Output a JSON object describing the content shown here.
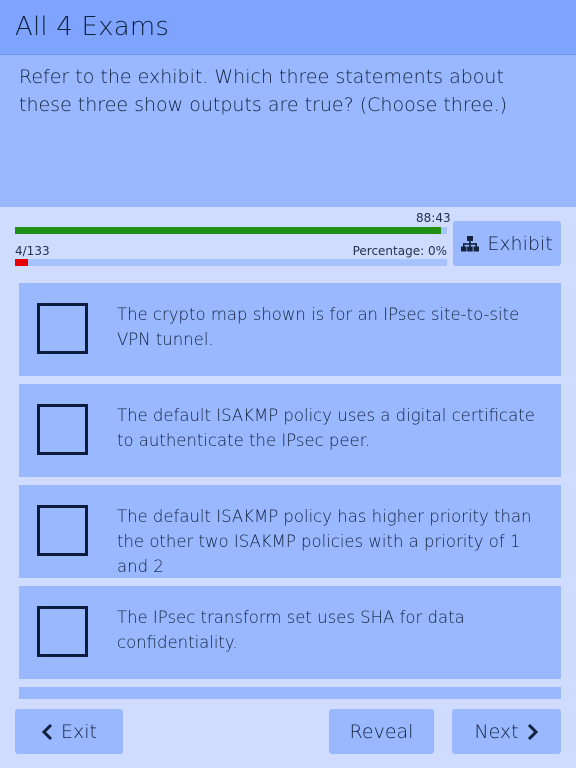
{
  "header": {
    "title": "All 4 Exams"
  },
  "question": {
    "text": "Refer to the exhibit. Which three statements about these three show outputs are true? (Choose three.)"
  },
  "status": {
    "timer": "88:43",
    "time_remaining_fraction": 0.985,
    "progress": "4/133",
    "progress_fraction": 0.03,
    "percentage": "Percentage: 0%"
  },
  "exhibit": {
    "label": "Exhibit",
    "icon": "sitemap-icon"
  },
  "options": [
    {
      "text": "The crypto map shown is for an IPsec site-to-site VPN tunnel.",
      "checked": false
    },
    {
      "text": "The default ISAKMP policy uses a digital certificate to authenticate the IPsec peer.",
      "checked": false
    },
    {
      "text": "The default ISAKMP policy has higher priority than the other two ISAKMP policies with a priority of 1 and 2",
      "checked": false
    },
    {
      "text": "The IPsec transform set uses SHA for data confidentiality.",
      "checked": false
    }
  ],
  "footer": {
    "exit_label": "Exit",
    "reveal_label": "Reveal",
    "next_label": "Next"
  },
  "colors": {
    "header": "#7ea4ff",
    "panel": "#9ab8ff",
    "background": "#cfdcff",
    "time_bar": "#1f8f16",
    "progress_bar": "#e60000"
  }
}
